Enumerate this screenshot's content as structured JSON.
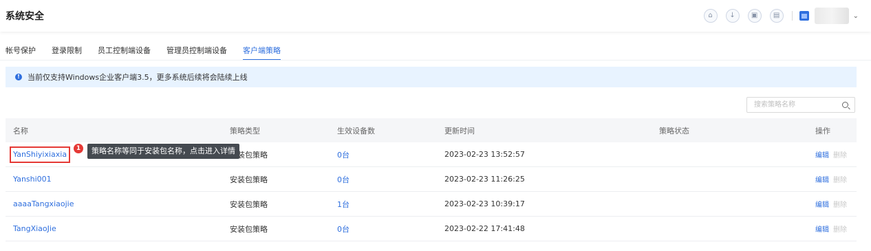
{
  "page": {
    "title": "系统安全"
  },
  "header_icons": [
    "home-icon",
    "download-icon",
    "calendar-icon",
    "clipboard-icon"
  ],
  "tabs": [
    {
      "label": "帐号保护"
    },
    {
      "label": "登录限制"
    },
    {
      "label": "员工控制端设备"
    },
    {
      "label": "管理员控制端设备"
    },
    {
      "label": "客户端策略",
      "active": true
    }
  ],
  "notice": {
    "text": "当前仅支持Windows企业客户端3.5，更多系统后续将会陆续上线"
  },
  "search": {
    "placeholder": "搜索策略名称",
    "value": ""
  },
  "table": {
    "headers": [
      "名称",
      "策略类型",
      "生效设备数",
      "更新时间",
      "策略状态",
      "操作"
    ],
    "rows": [
      {
        "name": "YanShiyixiaxia",
        "type": "安装包策略",
        "devices": "0台",
        "updated": "2023-02-23 13:52:57",
        "enabled": true
      },
      {
        "name": "Yanshi001",
        "type": "安装包策略",
        "devices": "0台",
        "updated": "2023-02-23 11:26:25",
        "enabled": true
      },
      {
        "name": "aaaaTangxiaojie",
        "type": "安装包策略",
        "devices": "1台",
        "updated": "2023-02-23 10:39:17",
        "enabled": true
      },
      {
        "name": "TangXiaoJie",
        "type": "安装包策略",
        "devices": "0台",
        "updated": "2023-02-22 17:41:48",
        "enabled": false
      }
    ],
    "actions": {
      "edit": "编辑",
      "delete": "删除"
    }
  },
  "annotation": {
    "badge": "1",
    "tooltip": "策略名称等同于安装包名称，点击进入详情"
  },
  "colors": {
    "accent": "#2f6fde",
    "highlight": "#e53935",
    "notice_bg": "#e8f3ff"
  }
}
